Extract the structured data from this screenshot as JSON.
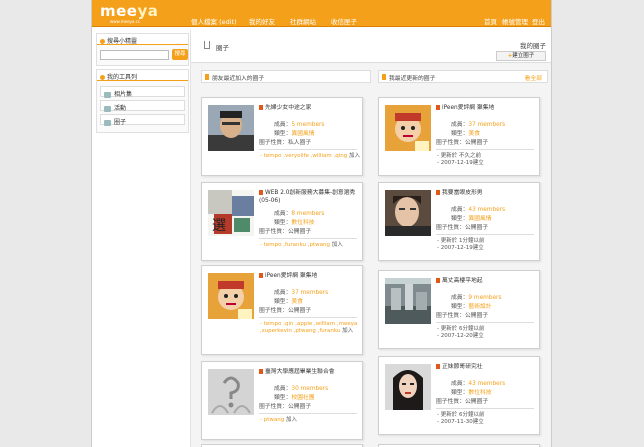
{
  "logo": {
    "main": "mee",
    "accent": "ya",
    "sub": "www.meeya.cc"
  },
  "nav": {
    "left": [
      "個人檔案 (edit)",
      "我的好友",
      "社群網站",
      "收信匣子"
    ],
    "right": [
      "首頁",
      "帳號管理",
      "登出"
    ]
  },
  "sidebar": {
    "search_title": "搜尋小精靈",
    "search_button": "搜尋",
    "search_placeholder": "",
    "tools_title": "我的工具列",
    "tools": [
      "相片集",
      "活動",
      "圈子"
    ]
  },
  "main": {
    "title": "圈子",
    "my_circles": "我的圈子",
    "create_button": "建立圈子",
    "left_bar": "朋友最近加入的圈子",
    "right_bar": "我最近更新的圈子",
    "right_more": "看全部"
  },
  "colors": {
    "accent": "#f5a01a",
    "brand": "#f5a01a",
    "flag": "#e0591b"
  },
  "left_cards": [
    {
      "name": "先婦少女中途之家",
      "members_label": "成員：",
      "members": "5 members",
      "type_label": "類型：",
      "type": "異國風情",
      "privacy_label": "圈子性質：",
      "privacy": "私人圈子",
      "foot_links": "- tempo ,veryolife ,william ,qing",
      "foot_suffix": "加入",
      "thumb": "portrait"
    },
    {
      "name": "WEB 2.0創新服務大募集-創意選秀(05-06)",
      "members_label": "成員：",
      "members": "8 members",
      "type_label": "類型：",
      "type": "數位科技",
      "privacy_label": "圈子性質：",
      "privacy": "公開圈子",
      "foot_links": "- tempo ,furanku ,ptwang",
      "foot_suffix": "加入",
      "thumb": "poster"
    },
    {
      "name": "iPeen愛評網 聚集地",
      "members_label": "成員：",
      "members": "37 members",
      "type_label": "類型：",
      "type": "美食",
      "privacy_label": "圈子性質：",
      "privacy": "公開圈子",
      "foot_links": "- tempo ,qin ,apple ,william ,meeya ,superkevin ,ptwang ,furanku",
      "foot_suffix": "加入",
      "thumb": "cartoon"
    },
    {
      "name": "臺灣大學應屆畢業生聯合會",
      "members_label": "成員：",
      "members": "30 members",
      "type_label": "類型：",
      "type": "校園社團",
      "privacy_label": "圈子性質：",
      "privacy": "公開圈子",
      "foot_links": "- ptwang",
      "foot_suffix": "加入",
      "thumb": "sketch"
    }
  ],
  "right_cards": [
    {
      "name": "iPeen愛評網 聚集地",
      "members_label": "成員：",
      "members": "37 members",
      "type_label": "類型：",
      "type": "美食",
      "privacy_label": "圈子性質：",
      "privacy": "公開圈子",
      "foot1": "- 更新於 不久之前",
      "foot2": "- 2007-12-19建立",
      "thumb": "cartoon"
    },
    {
      "name": "我要當眼皮形男",
      "members_label": "成員：",
      "members": "43 members",
      "type_label": "類型：",
      "type": "異國風情",
      "privacy_label": "圈子性質：",
      "privacy": "公開圈子",
      "foot1": "- 更新於 1分鐘以前",
      "foot2": "- 2007-12-19建立",
      "thumb": "face"
    },
    {
      "name": "萬丈高樓平地起",
      "members_label": "成員：",
      "members": "9 members",
      "type_label": "類型：",
      "type": "藝術設計",
      "privacy_label": "圈子性質：",
      "privacy": "公開圈子",
      "foot1": "- 更新於 6分鐘以前",
      "foot2": "- 2007-12-20建立",
      "thumb": "building"
    },
    {
      "name": "正妹節哥研究社",
      "members_label": "成員：",
      "members": "43 members",
      "type_label": "類型：",
      "type": "數位科技",
      "privacy_label": "圈子性質：",
      "privacy": "公開圈子",
      "foot1": "- 更新於 6分鐘以前",
      "foot2": "- 2007-11-30建立",
      "thumb": "girl"
    }
  ]
}
